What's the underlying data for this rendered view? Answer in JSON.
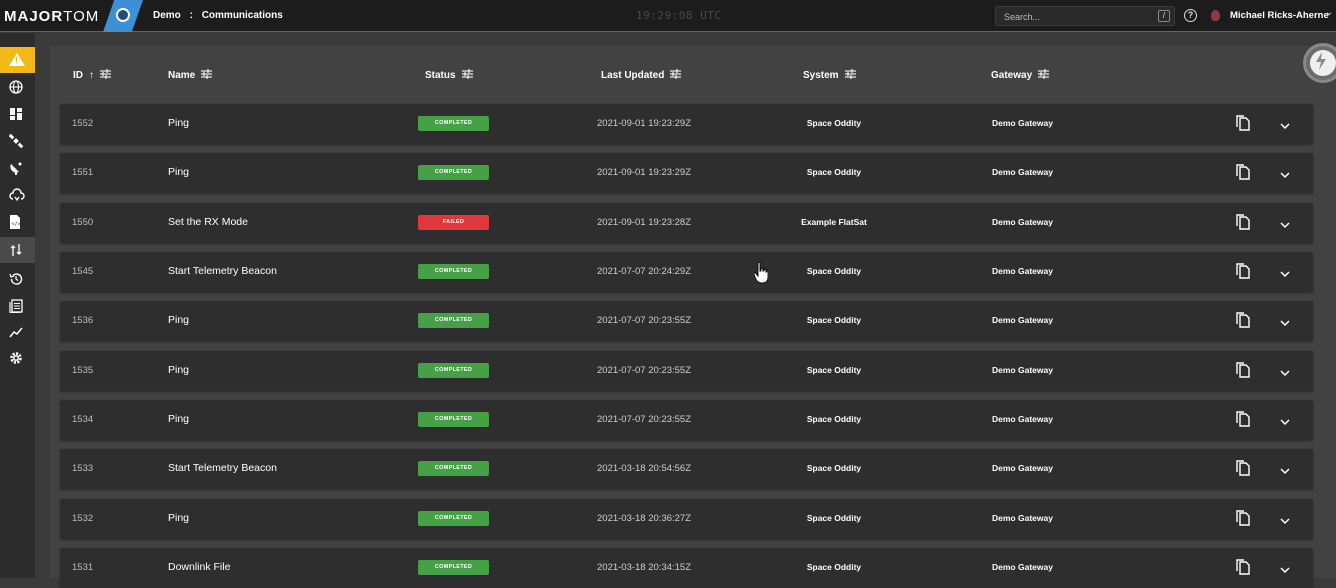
{
  "app": {
    "brand_bold": "MAJOR",
    "brand_thin": "TOM",
    "logo_icon": "astronaut-helmet-icon"
  },
  "breadcrumb": {
    "mission": "Demo",
    "separator": ":",
    "page": "Communications"
  },
  "clock": "19:29:08 UTC",
  "search": {
    "placeholder": "Search...",
    "shortcut": "/"
  },
  "help_label": "?",
  "user": {
    "name": "Michael Ricks-Aherne"
  },
  "sidebar": {
    "items": [
      {
        "icon": "alert-icon",
        "active": false
      },
      {
        "icon": "globe-icon",
        "active": false
      },
      {
        "icon": "dashboard-icon",
        "active": false
      },
      {
        "icon": "satellite-icon",
        "active": false
      },
      {
        "icon": "ground-station-icon",
        "active": false
      },
      {
        "icon": "cloud-sync-icon",
        "active": false
      },
      {
        "icon": "script-icon",
        "active": false
      },
      {
        "icon": "transfer-icon",
        "active": true
      },
      {
        "icon": "history-icon",
        "active": false
      },
      {
        "icon": "document-icon",
        "active": false
      },
      {
        "icon": "chart-icon",
        "active": false
      },
      {
        "icon": "gear-icon",
        "active": false
      }
    ]
  },
  "table": {
    "headers": {
      "id": "ID",
      "name": "Name",
      "status": "Status",
      "updated": "Last Updated",
      "system": "System",
      "gateway": "Gateway"
    },
    "rows": [
      {
        "id": "1552",
        "name": "Ping",
        "status": "COMPLETED",
        "updated": "2021-09-01 19:23:29Z",
        "system": "Space Oddity",
        "gateway": "Demo Gateway"
      },
      {
        "id": "1551",
        "name": "Ping",
        "status": "COMPLETED",
        "updated": "2021-09-01 19:23:29Z",
        "system": "Space Oddity",
        "gateway": "Demo Gateway"
      },
      {
        "id": "1550",
        "name": "Set the RX Mode",
        "status": "FAILED",
        "updated": "2021-09-01 19:23:28Z",
        "system": "Example FlatSat",
        "gateway": "Demo Gateway"
      },
      {
        "id": "1545",
        "name": "Start Telemetry Beacon",
        "status": "COMPLETED",
        "updated": "2021-07-07 20:24:29Z",
        "system": "Space Oddity",
        "gateway": "Demo Gateway"
      },
      {
        "id": "1536",
        "name": "Ping",
        "status": "COMPLETED",
        "updated": "2021-07-07 20:23:55Z",
        "system": "Space Oddity",
        "gateway": "Demo Gateway"
      },
      {
        "id": "1535",
        "name": "Ping",
        "status": "COMPLETED",
        "updated": "2021-07-07 20:23:55Z",
        "system": "Space Oddity",
        "gateway": "Demo Gateway"
      },
      {
        "id": "1534",
        "name": "Ping",
        "status": "COMPLETED",
        "updated": "2021-07-07 20:23:55Z",
        "system": "Space Oddity",
        "gateway": "Demo Gateway"
      },
      {
        "id": "1533",
        "name": "Start Telemetry Beacon",
        "status": "COMPLETED",
        "updated": "2021-03-18 20:54:56Z",
        "system": "Space Oddity",
        "gateway": "Demo Gateway"
      },
      {
        "id": "1532",
        "name": "Ping",
        "status": "COMPLETED",
        "updated": "2021-03-18 20:36:27Z",
        "system": "Space Oddity",
        "gateway": "Demo Gateway"
      },
      {
        "id": "1531",
        "name": "Downlink File",
        "status": "COMPLETED",
        "updated": "2021-03-18 20:34:15Z",
        "system": "Space Oddity",
        "gateway": "Demo Gateway"
      }
    ]
  },
  "colors": {
    "completed": "#46a045",
    "failed": "#e0383b",
    "alert": "#f4b918",
    "accent": "#3d8fd6"
  },
  "fab_icon": "lightning-bolt-icon"
}
